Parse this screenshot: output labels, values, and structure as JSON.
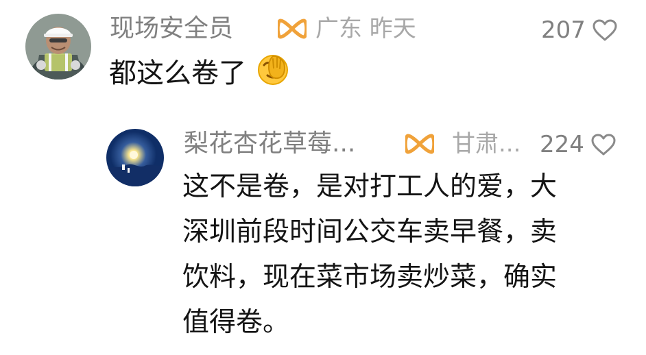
{
  "comments": [
    {
      "username": "现场安全员",
      "location": "广东 昨天",
      "likes": "207",
      "text": "都这么卷了",
      "emoji": "facepalm-emoji"
    }
  ],
  "replies": [
    {
      "username": "梨花杏花草莓...",
      "location": "甘肃...",
      "likes": "224",
      "text_lines": [
        "这不是卷，是对打工人的爱，大",
        "深圳前段时间公交车卖早餐，卖",
        "饮料，现在菜市场卖炒菜，确实",
        "值得卷。"
      ]
    }
  ],
  "icons": {
    "badge_color": "#f0a23a",
    "heart_color": "#8a8a8a"
  }
}
